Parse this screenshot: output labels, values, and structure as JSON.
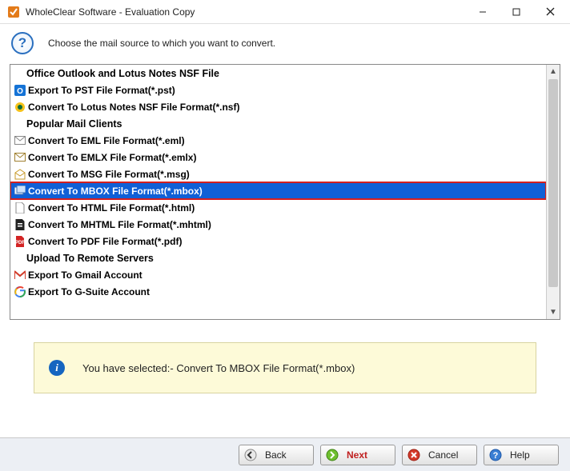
{
  "window": {
    "title": "WholeClear Software - Evaluation Copy"
  },
  "header": {
    "instruction": "Choose the mail source to which you want to convert."
  },
  "groups": {
    "office": "Office Outlook and Lotus Notes NSF File",
    "popular": "Popular Mail Clients",
    "upload": "Upload To Remote Servers"
  },
  "items": {
    "pst": "Export To PST File Format(*.pst)",
    "nsf": "Convert To Lotus Notes NSF File Format(*.nsf)",
    "eml": "Convert To EML File Format(*.eml)",
    "emlx": "Convert To EMLX File Format(*.emlx)",
    "msg": "Convert To MSG File Format(*.msg)",
    "mbox": "Convert To MBOX File Format(*.mbox)",
    "html": "Convert To HTML File Format(*.html)",
    "mhtml": "Convert To MHTML File Format(*.mhtml)",
    "pdf": "Convert To PDF File Format(*.pdf)",
    "gmail": "Export To Gmail Account",
    "gsuite": "Export To G-Suite Account"
  },
  "status": {
    "text": "You have selected:- Convert To MBOX File Format(*.mbox)"
  },
  "buttons": {
    "back": "Back",
    "next": "Next",
    "cancel": "Cancel",
    "help": "Help"
  },
  "colors": {
    "selection": "#1060d6",
    "highlight_border": "#d41f1f",
    "info_bg": "#fdfad8"
  }
}
